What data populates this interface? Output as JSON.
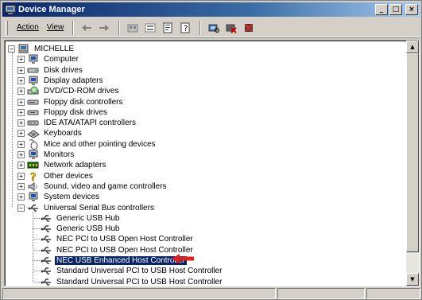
{
  "window": {
    "title": "Device Manager",
    "caption_buttons": [
      "_",
      "□",
      "×"
    ]
  },
  "menu": {
    "action": "Action",
    "view": "View"
  },
  "toolbar": {
    "icons": [
      "back-arrow-icon",
      "forward-arrow-icon",
      "up-folder-icon",
      "show-hide-tree-icon",
      "properties-icon",
      "help-icon",
      "scan-hardware-icon",
      "disable-device-icon",
      "uninstall-device-icon"
    ]
  },
  "tree": {
    "root": "MICHELLE",
    "categories": [
      {
        "label": "Computer",
        "icon": "computer-icon"
      },
      {
        "label": "Disk drives",
        "icon": "disk-drive-icon"
      },
      {
        "label": "Display adapters",
        "icon": "monitor-icon"
      },
      {
        "label": "DVD/CD-ROM drives",
        "icon": "cdrom-icon"
      },
      {
        "label": "Floppy disk controllers",
        "icon": "floppy-controller-icon"
      },
      {
        "label": "Floppy disk drives",
        "icon": "floppy-drive-icon"
      },
      {
        "label": "IDE ATA/ATAPI controllers",
        "icon": "ide-controller-icon"
      },
      {
        "label": "Keyboards",
        "icon": "keyboard-icon"
      },
      {
        "label": "Mice and other pointing devices",
        "icon": "mouse-icon"
      },
      {
        "label": "Monitors",
        "icon": "monitor-icon"
      },
      {
        "label": "Network adapters",
        "icon": "network-adapter-icon"
      },
      {
        "label": "Other devices",
        "icon": "unknown-device-icon"
      },
      {
        "label": "Sound, video and game controllers",
        "icon": "speaker-icon"
      },
      {
        "label": "System devices",
        "icon": "system-device-icon"
      },
      {
        "label": "Universal Serial Bus controllers",
        "icon": "usb-icon"
      }
    ],
    "usb_children": [
      "Generic USB Hub",
      "Generic USB Hub",
      "NEC PCI to USB Open Host Controller",
      "NEC PCI to USB Open Host Controller",
      "NEC USB Enhanced Host Controller",
      "Standard Universal PCI to USB Host Controller",
      "Standard Universal PCI to USB Host Controller"
    ],
    "selected_child": "NEC USB Enhanced Host Controller"
  },
  "colors": {
    "title_bar": "#0a246a",
    "selection": "#0a246a",
    "annotation_arrow": "#e0201a"
  }
}
